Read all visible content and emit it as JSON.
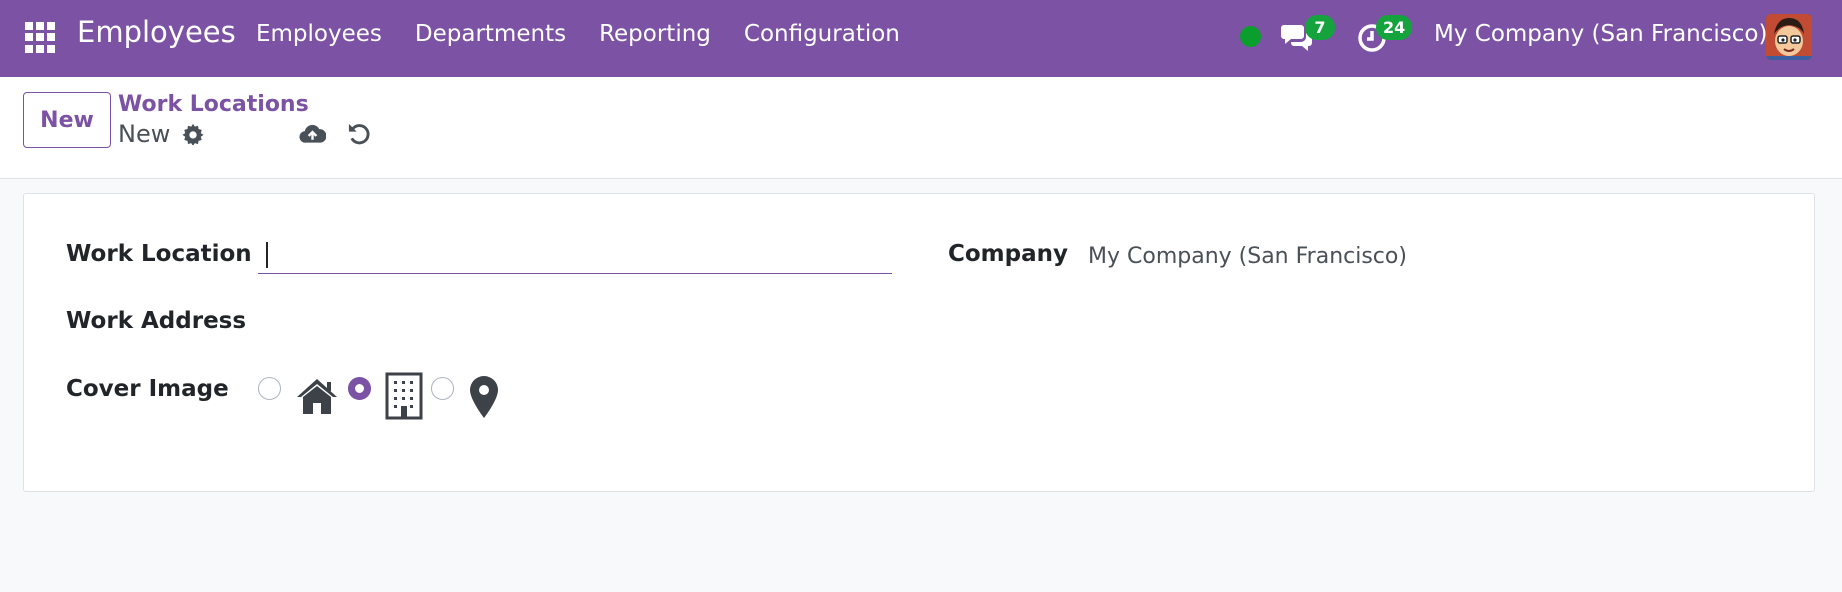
{
  "navbar": {
    "app_title": "Employees",
    "menu": [
      "Employees",
      "Departments",
      "Reporting",
      "Configuration"
    ],
    "messages_count": "7",
    "activities_count": "24",
    "company": "My Company (San Francisco)",
    "status_color": "#0a9f2d",
    "bg_color": "#7c52a4"
  },
  "controlbar": {
    "new_button": "New",
    "breadcrumb": "Work Locations",
    "record_name": "New"
  },
  "form": {
    "work_location_label": "Work Location",
    "work_location_value": "",
    "work_address_label": "Work Address",
    "cover_image_label": "Cover Image",
    "company_label": "Company",
    "company_value": "My Company (San Francisco)",
    "cover_image_options": [
      {
        "icon": "home-icon",
        "selected": false
      },
      {
        "icon": "building-icon",
        "selected": true
      },
      {
        "icon": "map-pin-icon",
        "selected": false
      }
    ]
  }
}
